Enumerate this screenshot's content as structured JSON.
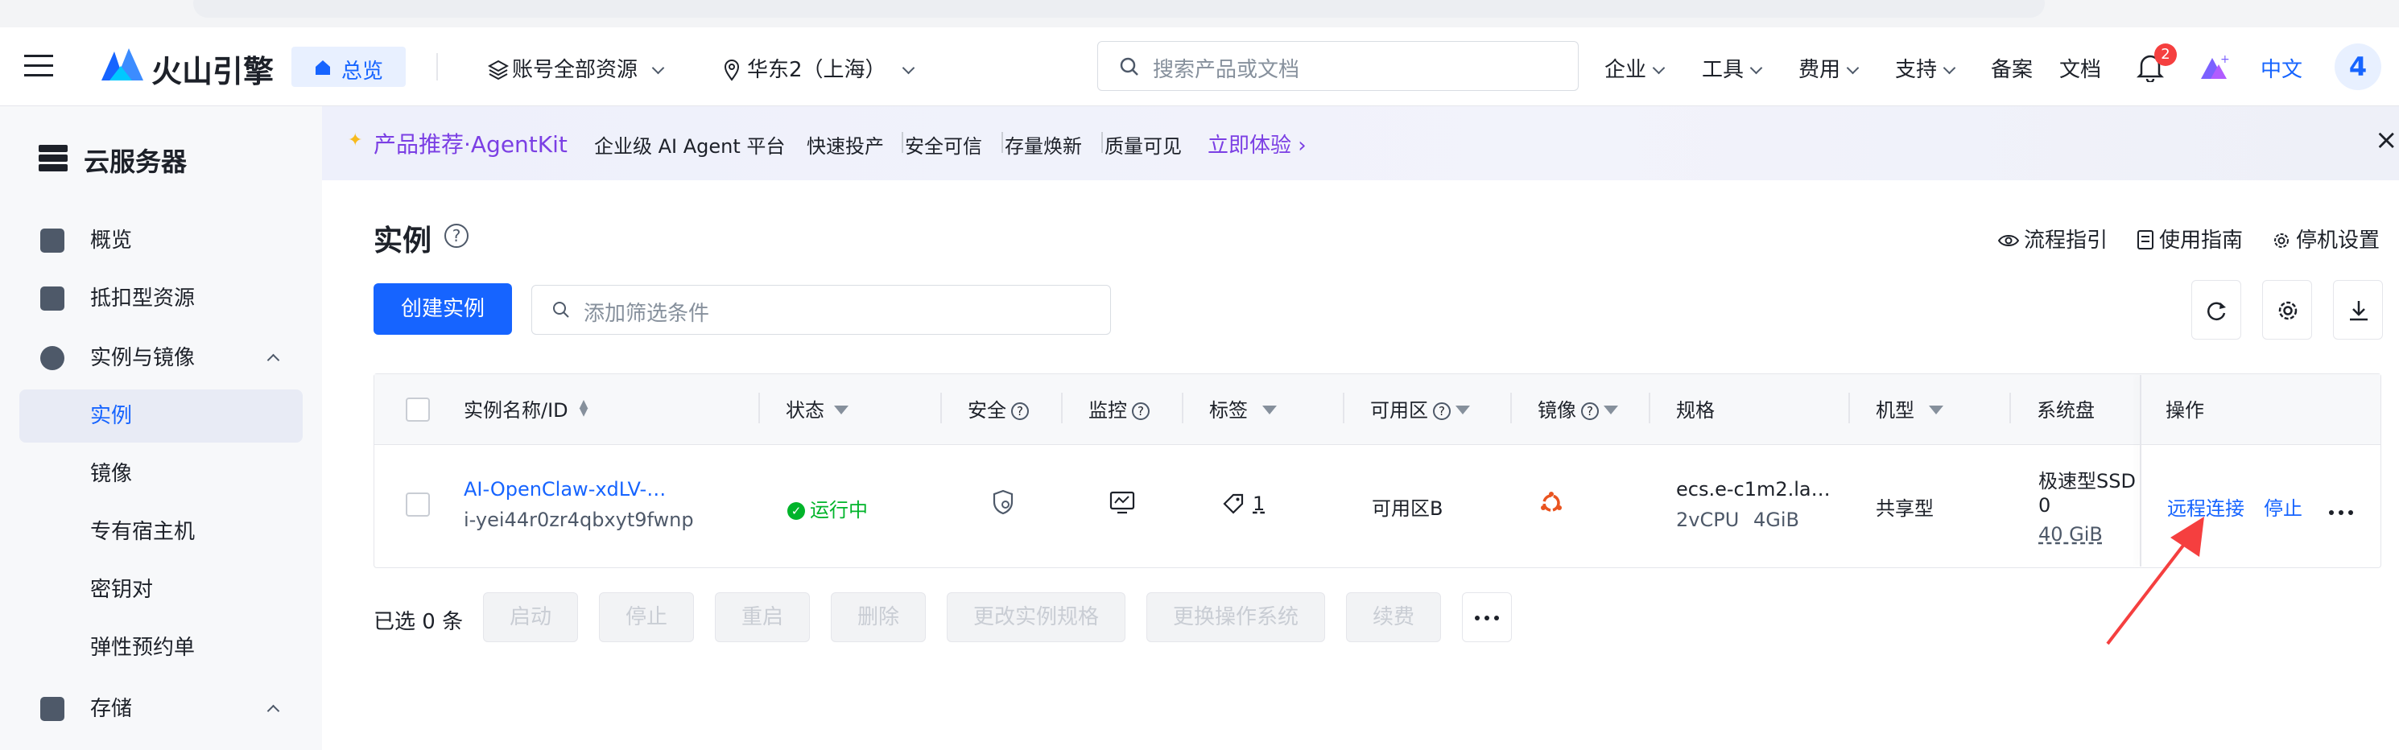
{
  "top_nav": {
    "brand": "火山引擎",
    "overview_tag": "总览",
    "scope": "账号全部资源",
    "region": "华东2（上海）",
    "search_placeholder": "搜索产品或文档",
    "menu": [
      "企业",
      "工具",
      "费用",
      "支持",
      "备案",
      "文档"
    ],
    "notification_count": "2",
    "language": "中文",
    "avatar": "4"
  },
  "sidebar": {
    "title": "云服务器",
    "items": [
      {
        "label": "概览"
      },
      {
        "label": "抵扣型资源"
      },
      {
        "label": "实例与镜像"
      },
      {
        "label": "实例"
      },
      {
        "label": "镜像"
      },
      {
        "label": "专有宿主机"
      },
      {
        "label": "密钥对"
      },
      {
        "label": "弹性预约单"
      },
      {
        "label": "存储"
      }
    ]
  },
  "banner": {
    "title": "产品推荐·AgentKit",
    "items": [
      "企业级 AI Agent 平台",
      "快速投产",
      "安全可信",
      "存量焕新",
      "质量可见"
    ],
    "cta": "立即体验"
  },
  "page": {
    "title": "实例",
    "links": [
      "流程指引",
      "使用指南",
      "停机设置"
    ],
    "create_button": "创建实例",
    "filter_placeholder": "添加筛选条件"
  },
  "table": {
    "headers": [
      "实例名称/ID",
      "状态",
      "安全",
      "监控",
      "标签",
      "可用区",
      "镜像",
      "规格",
      "机型",
      "系统盘",
      "操作"
    ],
    "row": {
      "name": "AI-OpenClaw-xdLV-…",
      "id": "i-yei44r0zr4qbxyt9fwnp",
      "status": "运行中",
      "tag_count": "1",
      "zone": "可用区B",
      "spec": "ecs.e-c1m2.la…",
      "cpu": "2vCPU",
      "mem": "4GiB",
      "machine_type": "共享型",
      "disk_type": "极速型SSD",
      "disk_count": "0",
      "disk_size": "40 GiB",
      "action_connect": "远程连接",
      "action_stop": "停止"
    }
  },
  "bulk": {
    "selected": "已选 0 条",
    "buttons": [
      "启动",
      "停止",
      "重启",
      "删除",
      "更改实例规格",
      "更换操作系统",
      "续费"
    ]
  },
  "colors": {
    "primary": "#1664ff",
    "running": "#00b42a",
    "arrow": "#f53f3f"
  }
}
